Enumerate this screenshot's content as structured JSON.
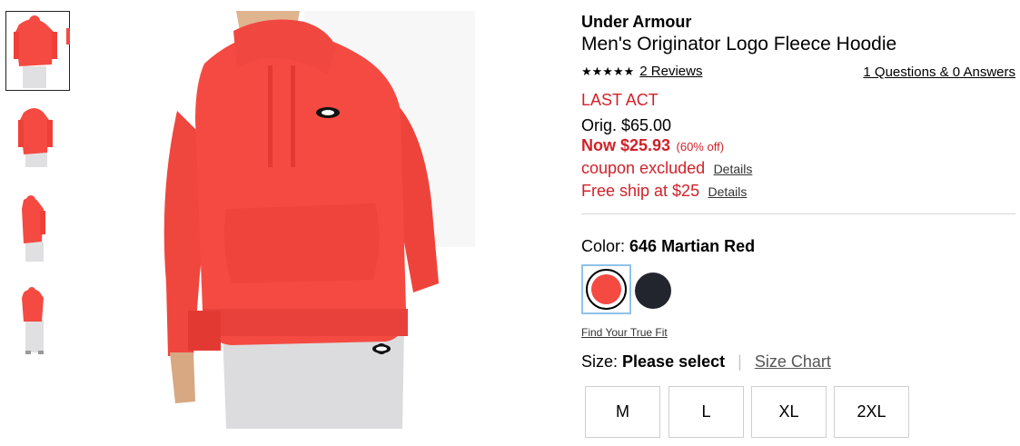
{
  "product": {
    "brand": "Under Armour",
    "title": "Men's Originator Logo Fleece Hoodie",
    "rating_stars": "★★★★★",
    "reviews_link": "2 Reviews",
    "qa_link": "1 Questions & 0 Answers",
    "badge": "LAST ACT",
    "orig_price": "Orig. $65.00",
    "now_price": "Now $25.93",
    "percent_off": "(60% off)",
    "coupon_text": "coupon excluded",
    "coupon_details": "Details",
    "ship_text": "Free ship at $25",
    "ship_details": "Details"
  },
  "color": {
    "label": "Color:",
    "selected": "646 Martian Red",
    "swatches": [
      {
        "name": "646 Martian Red",
        "hex": "#f44a42"
      },
      {
        "name": "Black",
        "hex": "#23252e"
      }
    ]
  },
  "fit_link": "Find Your True Fit",
  "size": {
    "label": "Size:",
    "selected": "Please select",
    "separator": "|",
    "chart_link": "Size Chart",
    "options": [
      "M",
      "L",
      "XL",
      "2XL"
    ]
  },
  "colors": {
    "sale_red": "#d1222a",
    "hoodie_red": "#f44a42",
    "swatch_selected_border": "#8fc3ea"
  }
}
